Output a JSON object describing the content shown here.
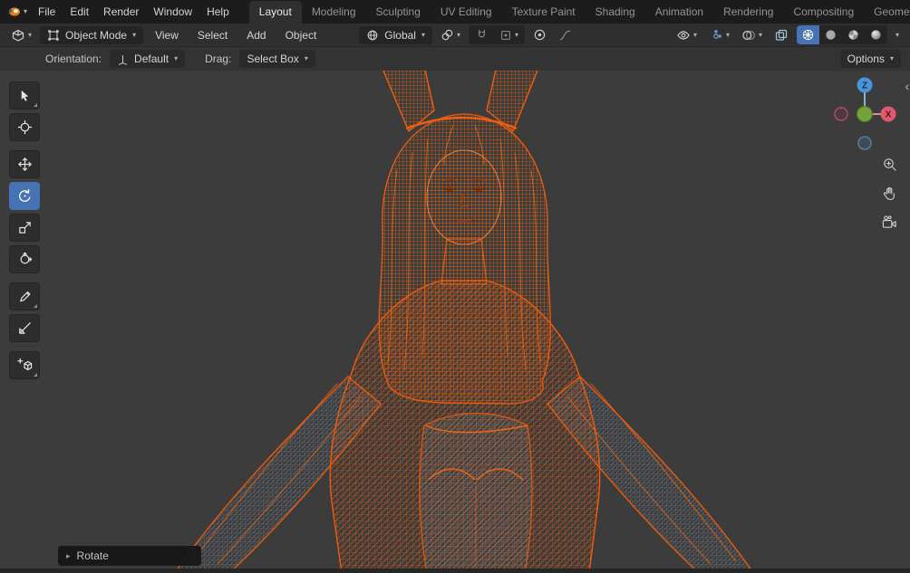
{
  "topbar": {
    "menus": [
      "File",
      "Edit",
      "Render",
      "Window",
      "Help"
    ],
    "tabs": [
      "Layout",
      "Modeling",
      "Sculpting",
      "UV Editing",
      "Texture Paint",
      "Shading",
      "Animation",
      "Rendering",
      "Compositing",
      "Geometry Nod"
    ],
    "active_tab": "Layout"
  },
  "viewport_header": {
    "mode": "Object Mode",
    "menus": [
      "View",
      "Select",
      "Add",
      "Object"
    ],
    "orientation": "Global"
  },
  "tool_settings": {
    "orientation_label": "Orientation:",
    "orientation_value": "Default",
    "drag_label": "Drag:",
    "drag_value": "Select Box",
    "options": "Options"
  },
  "toolbar": {
    "tools": [
      "select-box",
      "cursor",
      "move",
      "rotate",
      "scale",
      "transform",
      "annotate",
      "measure",
      "add-cube"
    ],
    "active_tool": "rotate"
  },
  "gizmo": {
    "axis_z": "Z",
    "axis_x": "X"
  },
  "nav": {
    "icons": [
      "zoom-icon",
      "pan-hand-icon",
      "camera-view-icon"
    ]
  },
  "operator_panel": {
    "label": "Rotate"
  },
  "icons": {
    "chevron_down": "▾",
    "panel_arrow": "▸",
    "sidebar_collapse": "‹"
  },
  "colors": {
    "accent_blue": "#4772b3",
    "selected_wire_orange": "#f26a12",
    "body_wire_gray": "#7b8694",
    "axis_x_red": "#dd5a70",
    "axis_z_blue": "#4a93d6",
    "axis_y_green": "#74a33c",
    "topbar_bg": "#1c1c1c",
    "header_bg": "#2f2f2f",
    "viewport_bg": "#3c3c3c"
  }
}
